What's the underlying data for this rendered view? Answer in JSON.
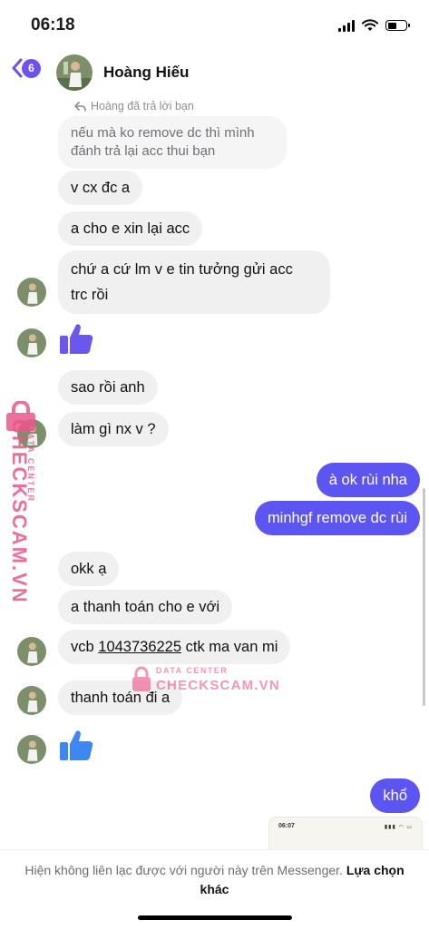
{
  "status": {
    "time": "06:18",
    "battery_level": 0.55
  },
  "header": {
    "back_badge": "6",
    "contact_name": "Hoàng Hiếu"
  },
  "chat": {
    "reply_note": "Hoàng đã trả lời bạn",
    "quoted_message": "nếu mà ko remove dc thì mình đánh trả lại acc thui bạn",
    "messages": [
      {
        "text": "v cx đc a"
      },
      {
        "text": "a cho e xin lại acc"
      },
      {
        "text": "chứ a cứ lm v e tin tưởng gửi acc"
      },
      {
        "text": "trc rồi"
      },
      {
        "text": "sao rồi anh"
      },
      {
        "text": "làm gì nx v ?"
      },
      {
        "text": "à ok rùi nha"
      },
      {
        "text": "minhgf remove dc rùi"
      },
      {
        "text": "okk ạ"
      },
      {
        "text": "a thanh toán cho e với"
      },
      {
        "text_prefix": "vcb ",
        "account": "1043736225",
        "text_suffix": " ctk ma van mi"
      },
      {
        "text": "thanh toán đi a"
      },
      {
        "text": "khổ"
      }
    ],
    "preview_time": "06:07"
  },
  "watermark": {
    "label": "DATA CENTER",
    "brand": "CHECKSCAM.VN"
  },
  "footer": {
    "notice": "Hiện không liên lạc được với người này trên Messenger.",
    "action": "Lựa chọn khác"
  },
  "colors": {
    "outgoing_bubble": "#5c55f2",
    "incoming_bubble": "#f0f0f0",
    "accent": "#6e52ec",
    "watermark": "#e8578a"
  },
  "icons": [
    "back-chevron-icon",
    "thumbs-up-icon",
    "reply-arrow-icon",
    "signal-icon",
    "wifi-icon",
    "battery-icon",
    "lock-icon"
  ]
}
